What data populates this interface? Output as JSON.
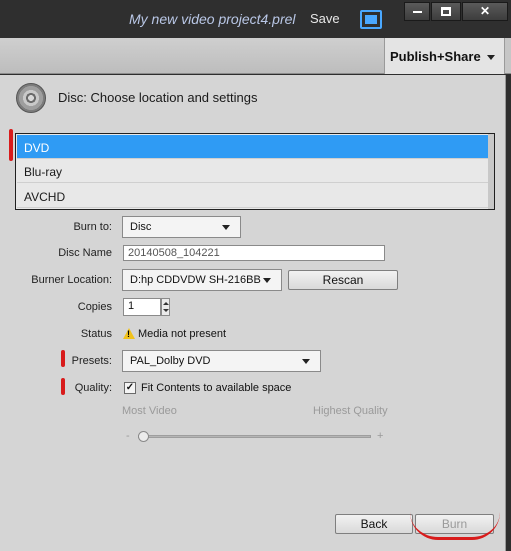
{
  "titlebar": {
    "project_title": "My new video project4.prel",
    "save_label": "Save"
  },
  "tabbar": {
    "publish_tab_label": "Publish+Share"
  },
  "panel": {
    "header_title": "Disc: Choose location and settings",
    "disc_types": [
      "DVD",
      "Blu-ray",
      "AVCHD"
    ],
    "selected_disc_type": "DVD",
    "burn_to": {
      "label": "Burn to:",
      "value": "Disc"
    },
    "disc_name": {
      "label": "Disc Name",
      "value": "20140508_104221"
    },
    "burner_location": {
      "label": "Burner Location:",
      "value": "D:hp CDDVDW SH-216BB",
      "rescan_label": "Rescan"
    },
    "copies": {
      "label": "Copies",
      "value": "1"
    },
    "status": {
      "label": "Status",
      "value": "Media not present"
    },
    "presets": {
      "label": "Presets:",
      "value": "PAL_Dolby DVD"
    },
    "quality": {
      "label": "Quality:",
      "checkbox_label": "Fit Contents to available space",
      "checked": true,
      "check_glyph": "✓"
    },
    "slider": {
      "min_label": "Most Video",
      "max_label": "Highest Quality",
      "minus": "-",
      "plus": "+",
      "level": 0.0
    },
    "back_label": "Back",
    "burn_label": "Burn"
  },
  "colors": {
    "selection": "#2f9bf4",
    "annotation": "#d81b1b",
    "title_text": "#b9c7e6"
  }
}
